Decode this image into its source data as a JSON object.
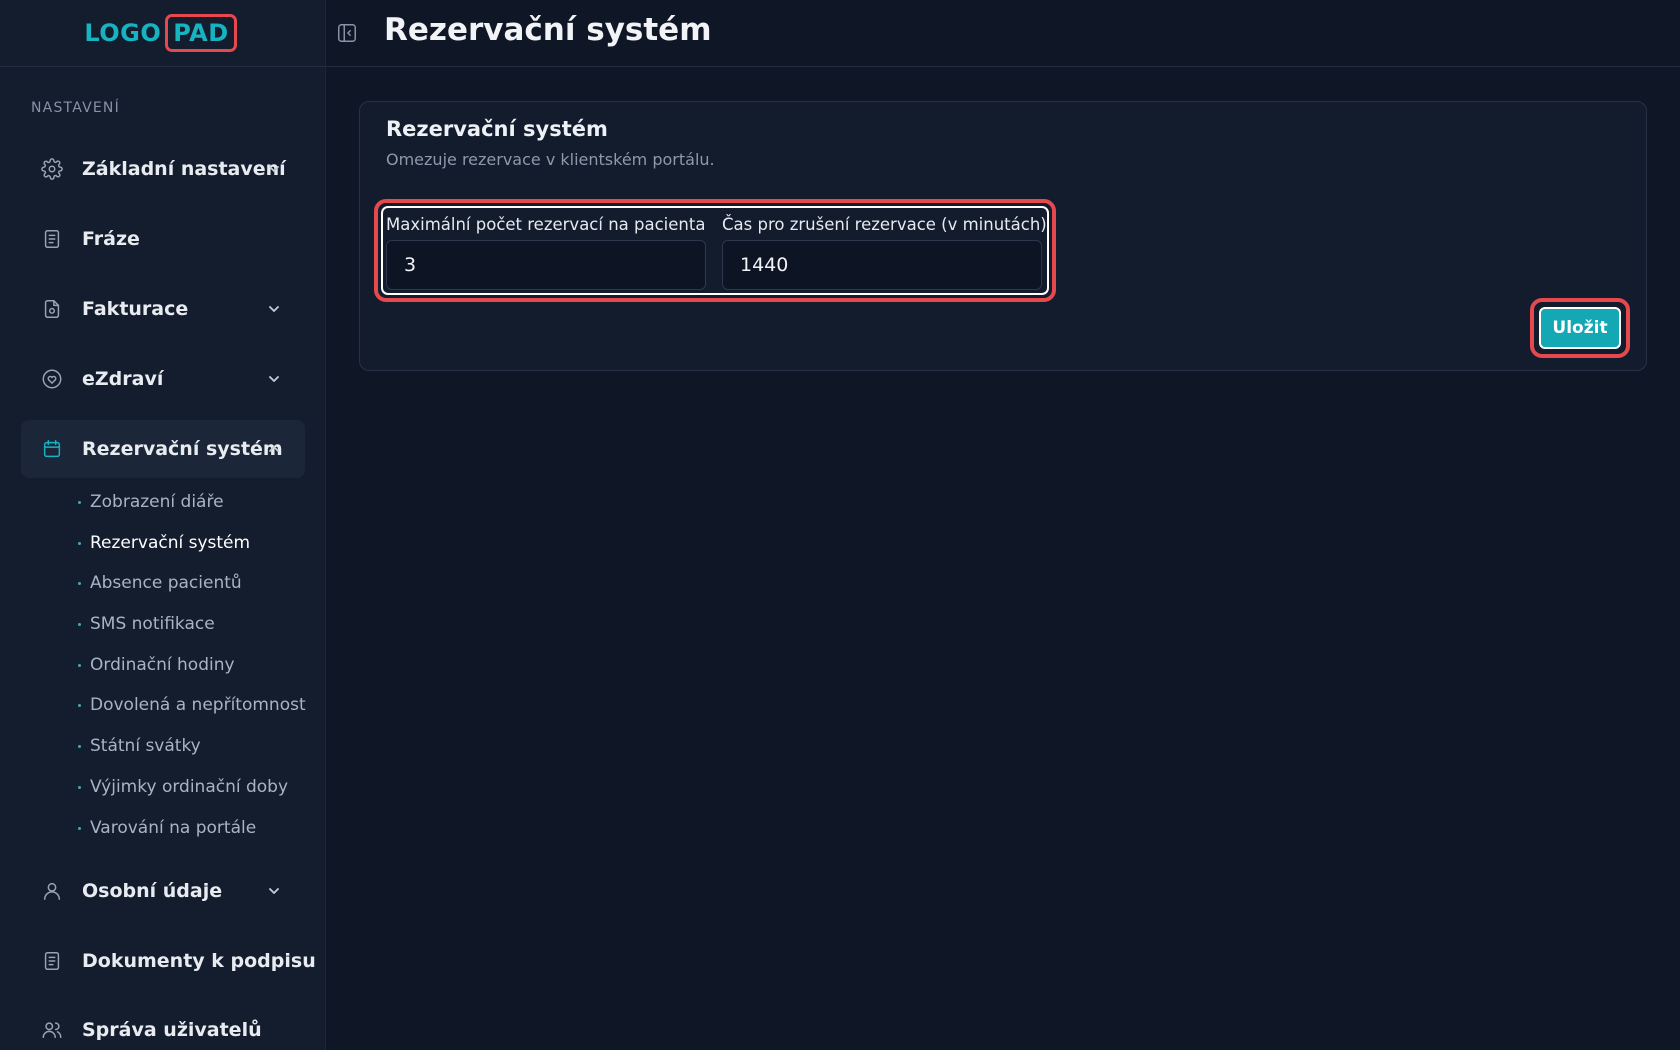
{
  "logo": {
    "part1": "LOGO",
    "part2": "PAD"
  },
  "header": {
    "title": "Rezervační systém"
  },
  "sidebar": {
    "section_label": "NASTAVENÍ",
    "items": [
      {
        "label": "Základní nastavení",
        "icon": "gear-icon",
        "expandable": true
      },
      {
        "label": "Fráze",
        "icon": "document-icon",
        "expandable": false
      },
      {
        "label": "Fakturace",
        "icon": "invoice-icon",
        "expandable": true
      },
      {
        "label": "eZdraví",
        "icon": "heart-icon",
        "expandable": true
      },
      {
        "label": "Rezervační systém",
        "icon": "calendar-icon",
        "expandable": true,
        "expanded": true
      }
    ],
    "subitems": [
      "Zobrazení diáře",
      "Rezervační systém",
      "Absence pacientů",
      "SMS notifikace",
      "Ordinační hodiny",
      "Dovolená a nepřítomnost",
      "Státní svátky",
      "Výjimky ordinační doby",
      "Varování na portále"
    ],
    "active_subitem": "Rezervační systém",
    "items_bottom": [
      {
        "label": "Osobní údaje",
        "icon": "user-icon",
        "expandable": true
      },
      {
        "label": "Dokumenty k podpisu",
        "icon": "document-icon",
        "expandable": false
      },
      {
        "label": "Správa uživatelů",
        "icon": "users-icon",
        "expandable": false
      }
    ]
  },
  "card": {
    "title": "Rezervační systém",
    "description": "Omezuje rezervace v klientském portálu.",
    "fields": [
      {
        "label": "Maximální počet rezervací na pacienta",
        "value": "3"
      },
      {
        "label": "Čas pro zrušení rezervace (v minutách)",
        "value": "1440"
      }
    ],
    "save_label": "Uložit"
  },
  "colors": {
    "accent": "#14a7b4",
    "highlight": "#e5484d",
    "background": "#0f1626",
    "sidebar": "#141d2e"
  }
}
